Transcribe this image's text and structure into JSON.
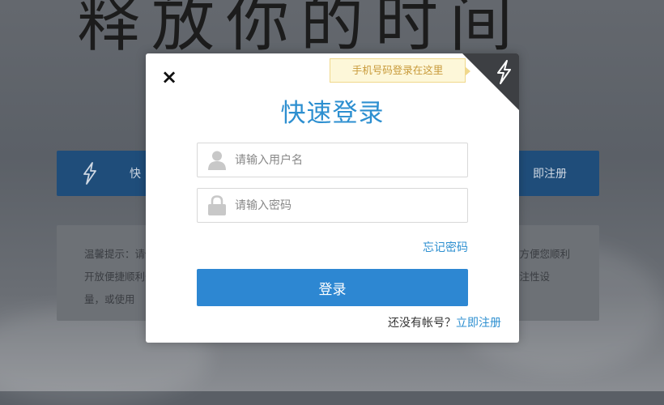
{
  "background": {
    "calligraphy": "释放你的时间",
    "bar_left_text": "快",
    "bar_right_text": "即注册",
    "tip_left_text": "温馨提示：请使用开放便捷顺利开展量，或使用",
    "tip_right_text": "录。为方便您顺利获取备注性设"
  },
  "modal": {
    "close_glyph": "×",
    "phone_tip": "手机号码登录在这里",
    "title": "快速登录",
    "username_placeholder": "请输入用户名",
    "password_placeholder": "请输入密码",
    "forgot_password": "忘记密码",
    "login_button": "登录",
    "register_prompt": "还没有帐号？",
    "register_link": "立即注册"
  },
  "colors": {
    "accent": "#2d8fd0",
    "button": "#2d87d2",
    "tip_bg": "#fdf7d9",
    "tip_text": "#c89a3a",
    "corner": "#3d3f43",
    "bg_bar": "#1f4d7a"
  },
  "icons": {
    "close": "close-icon",
    "lightning": "lightning-icon",
    "user": "user-icon",
    "lock": "lock-icon"
  }
}
